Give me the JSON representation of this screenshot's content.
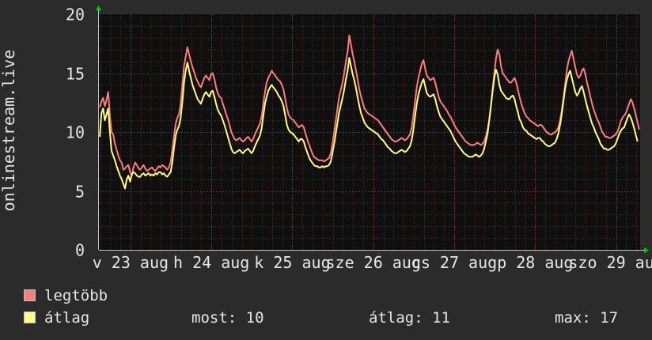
{
  "chart_data": {
    "type": "line",
    "ylabel": "onlinestream.live",
    "ylim": [
      0,
      20
    ],
    "yticks": [
      "0",
      "5",
      "10",
      "15",
      "20"
    ],
    "x_tick_labels": [
      "v 23 aug",
      "h 24 aug",
      "k 25 aug",
      "sze 26 aug",
      "cs 27 aug",
      "p 28 aug",
      "szo 29 aug"
    ],
    "grid": true,
    "legend_position": "bottom-left",
    "colors": {
      "background": "#2b2b2b",
      "plot_background": "#0f0f0f",
      "grid": "#5a2c2c",
      "major_grid": "#6a3030",
      "text": "#e6e6e6",
      "max_line": "#ff7c7c",
      "avg_line": "#ffff7c",
      "axis_arrow": "#00cc00"
    },
    "samples_per_day": 48,
    "series": [
      {
        "name": "legtöbb",
        "color": "#ff7c7c",
        "values": [
          12.1,
          12.6,
          12.9,
          12.2,
          12.7,
          13.4,
          11.4,
          10.0,
          9.8,
          9.0,
          8.5,
          8.0,
          7.6,
          7.4,
          6.8,
          6.9,
          7.1,
          7.2,
          6.6,
          6.3,
          7.0,
          7.4,
          7.2,
          6.9,
          6.8,
          7.0,
          7.2,
          6.9,
          6.7,
          6.8,
          6.9,
          7.0,
          6.8,
          6.7,
          6.9,
          7.1,
          7.0,
          7.2,
          7.1,
          7.0,
          6.8,
          7.0,
          7.4,
          8.4,
          9.6,
          10.7,
          11.2,
          11.5,
          12.4,
          14.0,
          15.6,
          16.4,
          17.2,
          16.6,
          16.0,
          15.5,
          15.1,
          14.6,
          14.3,
          14.0,
          13.8,
          14.2,
          14.6,
          14.8,
          14.6,
          14.4,
          14.9,
          15.0,
          14.5,
          13.8,
          13.3,
          13.0,
          12.9,
          12.4,
          12.0,
          11.5,
          11.1,
          10.6,
          10.0,
          9.7,
          9.4,
          9.3,
          9.4,
          9.5,
          9.3,
          9.2,
          9.3,
          9.5,
          9.6,
          9.4,
          9.2,
          9.4,
          9.8,
          10.1,
          10.4,
          10.7,
          11.3,
          12.4,
          13.4,
          14.2,
          14.6,
          14.9,
          15.2,
          15.0,
          14.8,
          14.6,
          14.4,
          14.3,
          14.0,
          13.6,
          12.8,
          12.0,
          11.5,
          11.2,
          11.1,
          11.0,
          10.8,
          10.6,
          10.4,
          10.5,
          10.6,
          10.4,
          9.9,
          9.4,
          9.0,
          8.6,
          8.2,
          7.9,
          7.8,
          7.7,
          7.6,
          7.6,
          7.6,
          7.5,
          7.6,
          7.7,
          7.8,
          8.2,
          9.0,
          10.0,
          11.0,
          12.0,
          13.0,
          13.6,
          14.2,
          15.0,
          16.0,
          16.8,
          18.2,
          17.4,
          16.6,
          16.0,
          15.2,
          14.4,
          13.6,
          13.0,
          12.5,
          12.0,
          11.8,
          11.6,
          11.5,
          11.4,
          11.3,
          11.2,
          11.1,
          11.0,
          10.8,
          10.6,
          10.4,
          10.2,
          10.0,
          9.8,
          9.6,
          9.4,
          9.3,
          9.2,
          9.2,
          9.3,
          9.4,
          9.5,
          9.4,
          9.3,
          9.4,
          9.6,
          9.8,
          10.4,
          11.4,
          12.6,
          13.8,
          14.6,
          15.2,
          15.8,
          16.1,
          15.4,
          14.8,
          14.6,
          14.4,
          14.5,
          14.6,
          14.2,
          13.6,
          13.0,
          12.6,
          12.4,
          12.2,
          12.0,
          11.8,
          11.5,
          11.3,
          11.0,
          10.7,
          10.4,
          10.2,
          10.0,
          9.8,
          9.6,
          9.4,
          9.2,
          9.1,
          9.0,
          8.9,
          8.9,
          8.9,
          9.0,
          9.1,
          9.0,
          8.9,
          9.0,
          9.2,
          9.6,
          10.2,
          11.0,
          12.2,
          13.6,
          15.0,
          16.2,
          17.0,
          16.6,
          15.6,
          15.0,
          14.8,
          14.6,
          14.4,
          14.2,
          14.2,
          14.4,
          14.6,
          14.2,
          13.6,
          13.0,
          12.4,
          12.0,
          11.6,
          11.3,
          11.2,
          11.0,
          10.9,
          10.8,
          10.7,
          10.6,
          10.5,
          10.6,
          10.6,
          10.4,
          10.2,
          10.0,
          9.9,
          9.8,
          9.8,
          9.9,
          10.0,
          10.1,
          10.4,
          11.0,
          11.8,
          12.8,
          14.0,
          15.2,
          16.0,
          16.5,
          16.9,
          16.2,
          15.5,
          14.9,
          14.6,
          14.8,
          15.2,
          15.4,
          14.9,
          14.2,
          13.6,
          13.0,
          12.4,
          11.9,
          11.5,
          11.1,
          10.8,
          10.4,
          10.0,
          9.8,
          9.6,
          9.6,
          9.5,
          9.5,
          9.6,
          9.7,
          9.8,
          10.0,
          10.4,
          10.9,
          11.2,
          11.4,
          11.6,
          12.0,
          12.4,
          12.8,
          12.5,
          12.0,
          11.4,
          10.8,
          10.2
        ]
      },
      {
        "name": "átlag",
        "color": "#ffff7c",
        "values": [
          9.6,
          11.6,
          12.0,
          11.0,
          11.5,
          12.0,
          10.0,
          8.4,
          8.0,
          7.6,
          7.1,
          6.7,
          6.3,
          6.0,
          5.6,
          5.2,
          6.0,
          6.3,
          5.8,
          6.4,
          6.6,
          6.5,
          6.3,
          6.2,
          6.2,
          6.4,
          6.5,
          6.3,
          6.4,
          6.5,
          6.3,
          6.4,
          6.3,
          6.5,
          6.4,
          6.6,
          6.6,
          6.4,
          6.5,
          6.3,
          6.2,
          6.4,
          6.6,
          7.4,
          8.6,
          9.7,
          10.2,
          10.5,
          11.2,
          12.6,
          14.2,
          15.2,
          15.9,
          15.2,
          14.6,
          14.0,
          13.6,
          13.2,
          12.8,
          12.6,
          12.4,
          12.8,
          13.2,
          13.4,
          13.2,
          13.0,
          13.4,
          13.5,
          13.0,
          12.4,
          11.9,
          11.6,
          11.4,
          11.0,
          10.6,
          10.1,
          9.6,
          9.1,
          8.6,
          8.3,
          8.2,
          8.3,
          8.4,
          8.5,
          8.3,
          8.2,
          8.4,
          8.5,
          8.6,
          8.4,
          8.2,
          8.4,
          8.8,
          9.1,
          9.4,
          9.7,
          10.3,
          11.4,
          12.4,
          13.0,
          13.5,
          13.8,
          14.0,
          13.8,
          13.6,
          13.4,
          13.1,
          12.9,
          12.6,
          12.2,
          11.4,
          10.6,
          10.2,
          10.0,
          9.9,
          9.8,
          9.6,
          9.4,
          9.2,
          9.4,
          9.4,
          9.2,
          8.7,
          8.3,
          7.9,
          7.6,
          7.4,
          7.2,
          7.1,
          7.1,
          7.0,
          7.0,
          7.1,
          7.0,
          7.1,
          7.1,
          7.2,
          7.5,
          8.2,
          9.0,
          9.9,
          10.8,
          11.7,
          12.3,
          12.9,
          13.6,
          14.5,
          15.2,
          16.3,
          15.6,
          14.9,
          14.4,
          13.7,
          12.9,
          12.2,
          11.6,
          11.2,
          10.8,
          10.6,
          10.4,
          10.3,
          10.2,
          10.1,
          10.0,
          9.9,
          9.8,
          9.6,
          9.4,
          9.3,
          9.1,
          8.9,
          8.7,
          8.6,
          8.4,
          8.3,
          8.2,
          8.2,
          8.3,
          8.4,
          8.5,
          8.4,
          8.3,
          8.4,
          8.6,
          8.8,
          9.3,
          10.2,
          11.3,
          12.4,
          13.2,
          13.7,
          14.2,
          14.5,
          13.9,
          13.3,
          13.1,
          13.0,
          13.1,
          13.2,
          12.8,
          12.2,
          11.7,
          11.3,
          11.1,
          10.9,
          10.7,
          10.5,
          10.3,
          10.1,
          9.8,
          9.5,
          9.2,
          9.0,
          8.8,
          8.6,
          8.4,
          8.2,
          8.1,
          8.0,
          7.9,
          7.9,
          7.9,
          8.0,
          8.1,
          8.0,
          7.9,
          8.0,
          8.2,
          8.6,
          9.2,
          9.9,
          11.0,
          12.2,
          13.5,
          14.6,
          15.3,
          14.9,
          14.0,
          13.5,
          13.3,
          13.1,
          12.9,
          12.8,
          12.8,
          13.0,
          13.1,
          12.8,
          12.2,
          11.7,
          11.1,
          10.8,
          10.4,
          10.2,
          10.1,
          9.9,
          9.8,
          9.7,
          9.6,
          9.5,
          9.4,
          9.5,
          9.5,
          9.3,
          9.2,
          9.0,
          8.9,
          8.8,
          8.8,
          8.9,
          9.0,
          9.1,
          9.4,
          9.9,
          10.6,
          11.5,
          12.6,
          13.7,
          14.4,
          14.9,
          15.2,
          14.6,
          14.0,
          13.4,
          13.1,
          13.3,
          13.7,
          13.9,
          13.4,
          12.8,
          12.2,
          11.7,
          11.2,
          10.7,
          10.4,
          10.0,
          9.7,
          9.4,
          9.0,
          8.8,
          8.6,
          8.6,
          8.5,
          8.5,
          8.6,
          8.7,
          8.8,
          9.0,
          9.4,
          9.8,
          10.1,
          10.3,
          10.4,
          10.8,
          11.2,
          11.5,
          11.2,
          10.8,
          10.3,
          9.7,
          9.2
        ]
      }
    ]
  },
  "legend": [
    {
      "label": "legtöbb",
      "color": "#ff7c7c"
    },
    {
      "label": "átlag",
      "color": "#ffff7c"
    }
  ],
  "stats": {
    "most": "most: 10",
    "atlag": "átlag: 11",
    "max": "max: 17"
  }
}
